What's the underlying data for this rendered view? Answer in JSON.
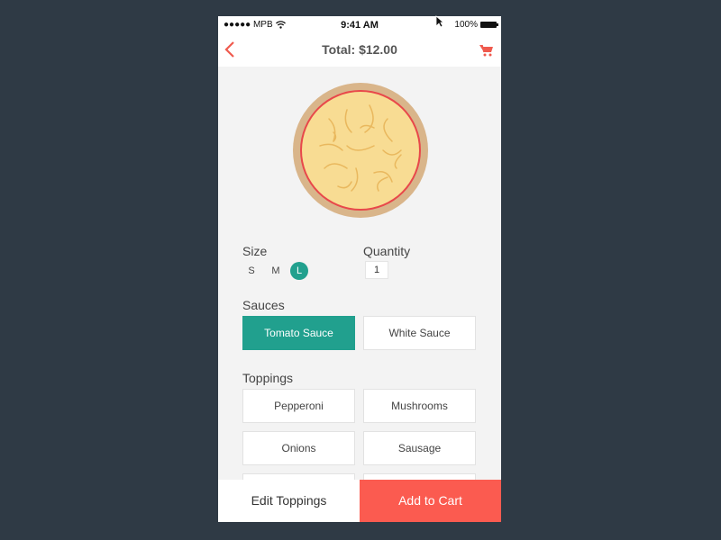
{
  "status_bar": {
    "carrier": "●●●●● MPB",
    "time": "9:41 AM",
    "battery": "100%"
  },
  "nav": {
    "title": "Total: $12.00",
    "back_icon": "chevron-left-icon",
    "cart_icon": "cart-icon"
  },
  "size": {
    "label": "Size",
    "options": [
      "S",
      "M",
      "L"
    ],
    "selected": "L"
  },
  "quantity": {
    "label": "Quantity",
    "value": "1"
  },
  "sauces": {
    "label": "Sauces",
    "options": [
      "Tomato Sauce",
      "White Sauce"
    ],
    "selected": "Tomato Sauce"
  },
  "toppings": {
    "label": "Toppings",
    "options": [
      "Pepperoni",
      "Mushrooms",
      "Onions",
      "Sausage"
    ]
  },
  "bottom_bar": {
    "edit_label": "Edit Toppings",
    "add_label": "Add to Cart"
  },
  "colors": {
    "accent": "#21a08e",
    "primary": "#fb5b50",
    "background": "#2f3a45"
  }
}
